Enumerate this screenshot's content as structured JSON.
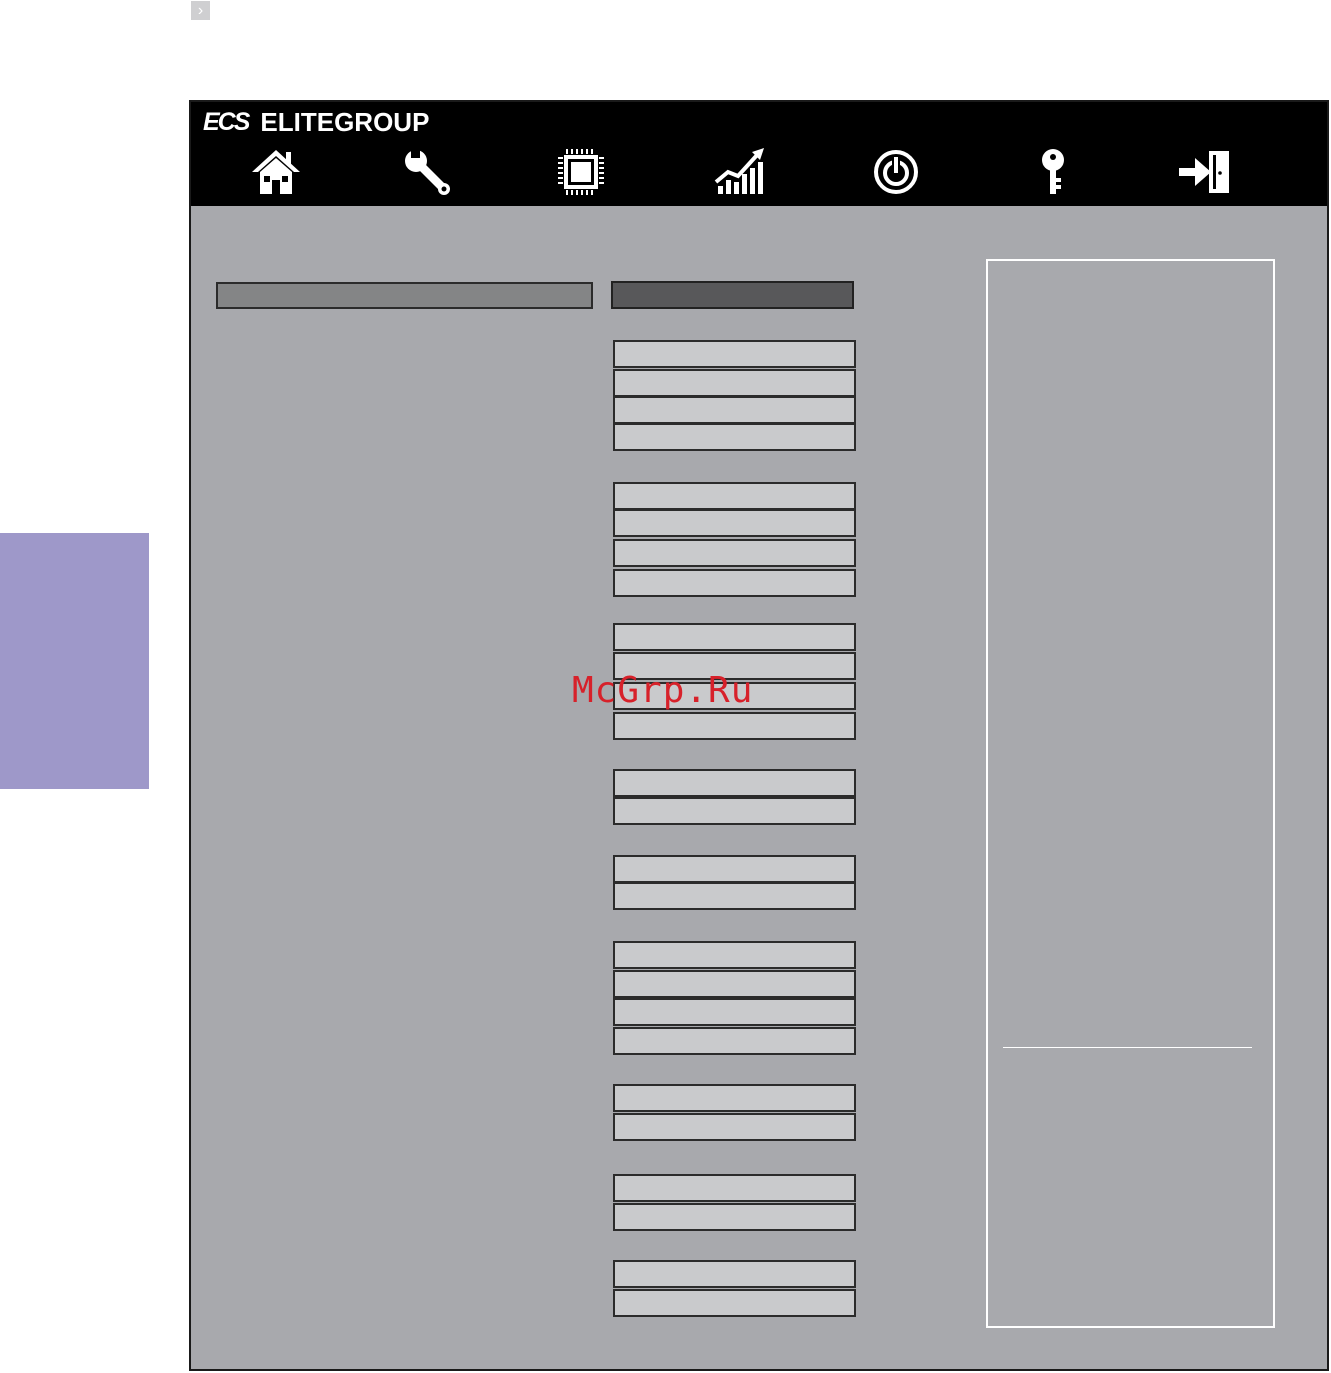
{
  "brand": {
    "logo": "ECS",
    "name": "ELITEGROUP"
  },
  "nav": [
    {
      "id": "main",
      "icon": "home-icon"
    },
    {
      "id": "advanced",
      "icon": "wrench-icon"
    },
    {
      "id": "chipset",
      "icon": "chip-icon"
    },
    {
      "id": "mi",
      "icon": "chart-icon"
    },
    {
      "id": "boot",
      "icon": "power-icon"
    },
    {
      "id": "security",
      "icon": "key-icon"
    },
    {
      "id": "exit",
      "icon": "exit-icon"
    }
  ],
  "watermark": "McGrp.Ru",
  "colors": {
    "topbar": "#000000",
    "body": "#a8a9ad",
    "field": "#c9cacc",
    "side_tab": "#9e98c9",
    "watermark": "#d7212a"
  }
}
